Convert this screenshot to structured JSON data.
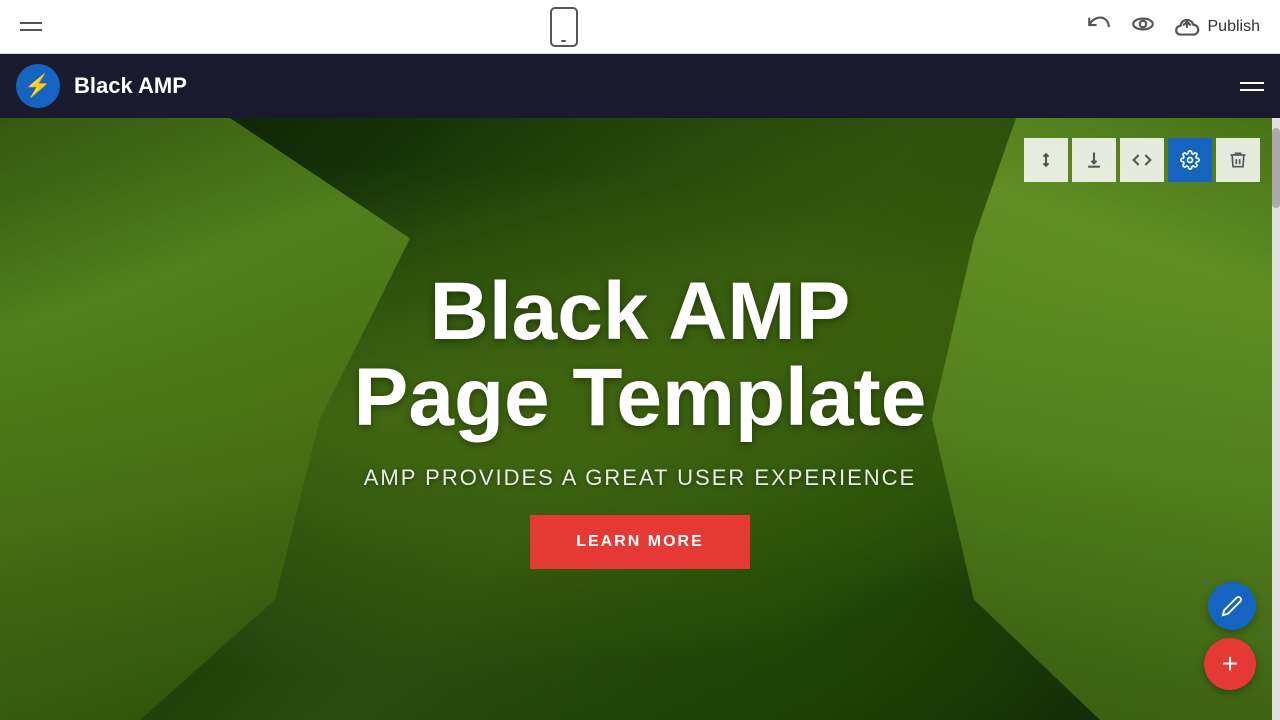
{
  "top_toolbar": {
    "hamburger_label": "menu",
    "mobile_label": "mobile-preview",
    "undo_label": "undo",
    "eye_label": "preview",
    "publish_label": "Publish",
    "cloud_label": "cloud-upload"
  },
  "app_header": {
    "logo_icon": "⚡",
    "title": "Black AMP",
    "menu_label": "app-menu"
  },
  "section_toolbar": {
    "reorder_icon": "↕",
    "download_icon": "↓",
    "code_icon": "</>",
    "settings_icon": "⚙",
    "delete_icon": "🗑"
  },
  "hero": {
    "title_line1": "Black AMP",
    "title_line2": "Page Template",
    "subtitle": "AMP PROVIDES A GREAT USER EXPERIENCE",
    "cta_label": "LEARN MORE"
  },
  "fab": {
    "edit_icon": "✏",
    "add_icon": "+"
  }
}
